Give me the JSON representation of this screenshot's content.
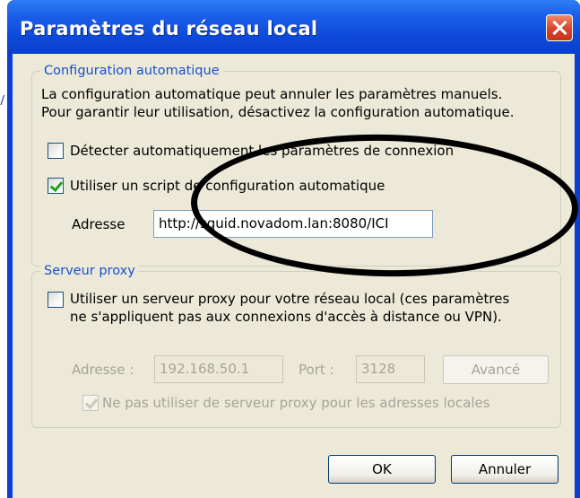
{
  "window": {
    "title": "Paramètres du réseau local"
  },
  "auto_config": {
    "legend": "Configuration automatique",
    "description_line1": "La configuration automatique peut annuler les paramètres manuels.",
    "description_line2": "Pour garantir leur utilisation, désactivez la configuration automatique.",
    "detect_label": "Détecter automatiquement les paramètres de connexion",
    "detect_checked": false,
    "script_label": "Utiliser un script de configuration automatique",
    "script_checked": true,
    "address_label": "Adresse",
    "address_value": "http://squid.novadom.lan:8080/ICI"
  },
  "proxy": {
    "legend": "Serveur proxy",
    "use_label_line1": "Utiliser un serveur proxy pour votre réseau local (ces paramètres",
    "use_label_line2": "ne s'appliquent pas aux connexions d'accès à distance ou VPN).",
    "use_checked": false,
    "address_label": "Adresse :",
    "address_value": "192.168.50.1",
    "port_label": "Port :",
    "port_value": "3128",
    "advanced_label": "Avancé",
    "bypass_label": "Ne pas utiliser de serveur proxy pour les adresses locales",
    "bypass_checked": true
  },
  "buttons": {
    "ok": "OK",
    "cancel": "Annuler"
  },
  "colors": {
    "title_bar": "#0a3fd6",
    "dialog_bg": "#ece9d8",
    "group_legend": "#1a50c8",
    "annotation": "#000000"
  }
}
